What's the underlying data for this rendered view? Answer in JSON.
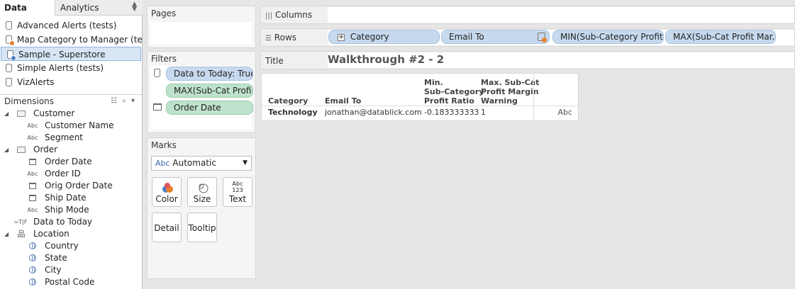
{
  "left_pane": {
    "tabs": {
      "data": "Data",
      "analytics": "Analytics"
    },
    "datasources": [
      {
        "label": "Advanced Alerts (tests)",
        "badge": ""
      },
      {
        "label": "Map Category to Manager (te...",
        "badge": "orange"
      },
      {
        "label": "Sample - Superstore",
        "badge": "blue",
        "selected": true
      },
      {
        "label": "Simple Alerts (tests)",
        "badge": ""
      },
      {
        "label": "VizAlerts",
        "badge": ""
      }
    ],
    "dimensions_header": "Dimensions",
    "fields": {
      "customer": "Customer",
      "customer_name": "Customer Name",
      "segment": "Segment",
      "order": "Order",
      "order_date": "Order Date",
      "order_id": "Order ID",
      "orig_order_date": "Orig Order Date",
      "ship_date": "Ship Date",
      "ship_mode": "Ship Mode",
      "data_to_today": "Data to Today",
      "location": "Location",
      "country": "Country",
      "state": "State",
      "city": "City",
      "postal_code": "Postal Code"
    },
    "type_icons": {
      "abc": "Abc",
      "tf": "=T|F"
    }
  },
  "pages_card": {
    "title": "Pages"
  },
  "filters_card": {
    "title": "Filters",
    "pills": [
      "Data to Today: True",
      "MAX(Sub-Cat Profi..",
      "Order Date"
    ]
  },
  "marks_card": {
    "title": "Marks",
    "type_icon": "Abc",
    "type": "Automatic",
    "buttons": {
      "color": "Color",
      "size": "Size",
      "text": "Text",
      "detail": "Detail",
      "tooltip": "Tooltip"
    },
    "text_icon": "Abc\n123"
  },
  "shelves": {
    "columns_label": "Columns",
    "rows_label": "Rows",
    "row_pills": [
      "Category",
      "Email To",
      "MIN(Sub-Category Profit..",
      "MAX(Sub-Cat Profit Mar.."
    ]
  },
  "title_shelf": {
    "label": "Title",
    "text": "Walkthrough #2 - 2"
  },
  "viz": {
    "headers": {
      "category": "Category",
      "email_to": "Email To",
      "min_1": "Min.",
      "min_2": "Sub-Category",
      "min_3": "Profit Ratio",
      "max_1": "Max. Sub-Cat",
      "max_2": "Profit Margin",
      "max_3": "Warning"
    },
    "row": {
      "category": "Technology",
      "email": "jonathan@datablick.com",
      "min_ratio": "-0.183333333",
      "max_warning": "1",
      "text": "Abc"
    }
  }
}
